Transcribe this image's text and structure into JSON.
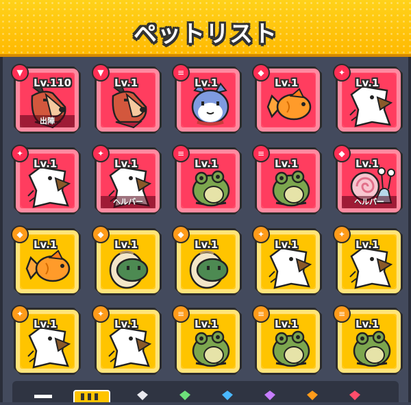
{
  "header": {
    "title": "ペットリスト"
  },
  "pets": [
    {
      "level": "Lv.110",
      "frame": "red",
      "pet": "dog",
      "status": "出陣",
      "badge": "dog"
    },
    {
      "level": "Lv.1",
      "frame": "red",
      "pet": "dog",
      "status": "",
      "badge": "dog"
    },
    {
      "level": "Lv.1",
      "frame": "red",
      "pet": "cat",
      "status": "",
      "badge": "stack"
    },
    {
      "level": "Lv.1",
      "frame": "red",
      "pet": "goldfish",
      "status": "",
      "badge": "shell"
    },
    {
      "level": "Lv.1",
      "frame": "red",
      "pet": "bird",
      "status": "",
      "badge": "bird"
    },
    {
      "level": "Lv.1",
      "frame": "red",
      "pet": "bird",
      "status": "",
      "badge": "bird"
    },
    {
      "level": "Lv.1",
      "frame": "red",
      "pet": "bird",
      "status": "ヘルパー",
      "badge": "bird"
    },
    {
      "level": "Lv.1",
      "frame": "red",
      "pet": "frog",
      "status": "",
      "badge": "stack"
    },
    {
      "level": "Lv.1",
      "frame": "red",
      "pet": "frog",
      "status": "",
      "badge": "stack"
    },
    {
      "level": "Lv.1",
      "frame": "red",
      "pet": "snail",
      "status": "ヘルパー",
      "badge": "shell"
    },
    {
      "level": "Lv.1",
      "frame": "gold",
      "pet": "goldfish",
      "status": "",
      "badge": "shell"
    },
    {
      "level": "Lv.1",
      "frame": "gold",
      "pet": "turtle",
      "status": "",
      "badge": "shell"
    },
    {
      "level": "Lv.1",
      "frame": "gold",
      "pet": "turtle",
      "status": "",
      "badge": "shell"
    },
    {
      "level": "Lv.1",
      "frame": "gold",
      "pet": "bird",
      "status": "",
      "badge": "bird"
    },
    {
      "level": "Lv.1",
      "frame": "gold",
      "pet": "bird",
      "status": "",
      "badge": "bird"
    },
    {
      "level": "Lv.1",
      "frame": "gold",
      "pet": "bird",
      "status": "",
      "badge": "bird"
    },
    {
      "level": "Lv.1",
      "frame": "gold",
      "pet": "bird",
      "status": "",
      "badge": "bird"
    },
    {
      "level": "Lv.1",
      "frame": "gold",
      "pet": "frog",
      "status": "",
      "badge": "stack"
    },
    {
      "level": "Lv.1",
      "frame": "gold",
      "pet": "frog",
      "status": "",
      "badge": "stack"
    },
    {
      "level": "Lv.1",
      "frame": "gold",
      "pet": "frog",
      "status": "",
      "badge": "stack"
    }
  ],
  "colors": {
    "red_frame": "#ff4d6b",
    "gold_frame": "#ffcb1f",
    "header": "#ffc400"
  }
}
